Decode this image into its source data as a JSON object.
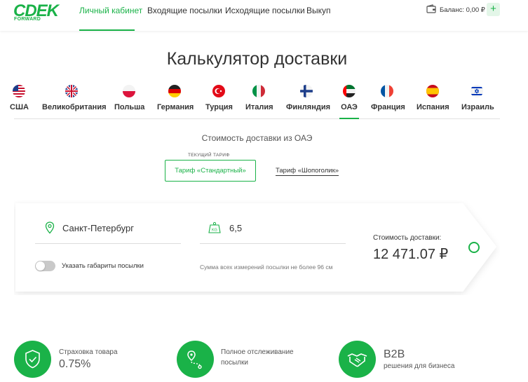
{
  "brand": {
    "logo_text": "CDEK",
    "logo_sub": "FORWARD",
    "color": "#1ab248"
  },
  "nav": {
    "items": [
      "Личный кабинет",
      "Входящие посылки",
      "Исходящие посылки",
      "Выкуп"
    ],
    "active_index": 0
  },
  "account": {
    "balance": "Баланс: 0,00 ₽",
    "add_label": "+"
  },
  "page": {
    "title": "Калькулятор доставки",
    "subtitle": "Стоимость доставки из ОАЭ"
  },
  "countries": [
    {
      "label": "США",
      "flag": "us-flag-icon"
    },
    {
      "label": "Великобритания",
      "flag": "uk-flag-icon"
    },
    {
      "label": "Польша",
      "flag": "poland-flag-icon"
    },
    {
      "label": "Германия",
      "flag": "germany-flag-icon"
    },
    {
      "label": "Турция",
      "flag": "turkey-flag-icon"
    },
    {
      "label": "Италия",
      "flag": "italy-flag-icon"
    },
    {
      "label": "Финляндия",
      "flag": "finland-flag-icon"
    },
    {
      "label": "ОАЭ",
      "flag": "uae-flag-icon",
      "active": true
    },
    {
      "label": "Франция",
      "flag": "france-flag-icon"
    },
    {
      "label": "Испания",
      "flag": "spain-flag-icon"
    },
    {
      "label": "Израиль",
      "flag": "israel-flag-icon"
    }
  ],
  "tariffs": {
    "caption": "ТЕКУЩИЙ ТАРИФ",
    "active": "Тариф «Стандартный»",
    "other": "Тариф «Шопоголик»"
  },
  "calculator": {
    "city": "Санкт-Петербург",
    "weight": "6,5",
    "weight_unit": "KG",
    "dimensions_toggle_label": "Указать габариты посылки",
    "dimensions_toggle_on": false,
    "weight_hint": "Сумма всех измерений посылки не более 96 см",
    "cost_label": "Стоимость доставки:",
    "cost_value": "12 471.07 ₽"
  },
  "features": [
    {
      "title": "Страховка товара",
      "value": "0.75%",
      "icon": "shield-check-icon"
    },
    {
      "title": "Полное отслеживание",
      "title2": "посылки",
      "icon": "route-icon"
    },
    {
      "value": "B2B",
      "sub": "решения для бизнеса",
      "icon": "handshake-icon"
    }
  ]
}
